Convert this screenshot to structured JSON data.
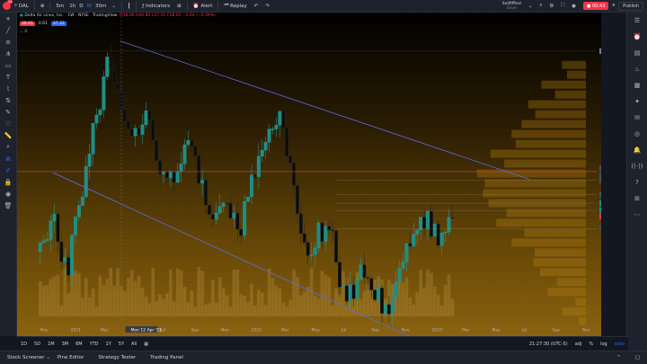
{
  "topbar": {
    "symbol": "DAL",
    "intervals": [
      "5m",
      "1h",
      "D",
      "W",
      "30m"
    ],
    "active_interval": "W",
    "indicators_label": "Indicators",
    "alert_label": "Alert",
    "replay_label": "Replay",
    "layout_name": "Sellfiffied",
    "layout_sub": "Save",
    "rec_time": "00:43",
    "publish_label": "Publish",
    "badge": "11"
  },
  "legend": {
    "title": "Delta Air Lines, Inc. · 1W · NYSE · TradingView",
    "ohlc": "O38.06 H40.80 L37.41 C38.65 −2.64 (−6.39%)",
    "bid": "36.61",
    "spread": "0.61",
    "ask": "37.22",
    "ind": "4"
  },
  "price_axis": {
    "ticks": [
      "53.00",
      "52.00",
      "51.00",
      "50.00",
      "49.00",
      "48.00",
      "47.00",
      "46.00",
      "45.00",
      "44.00",
      "43.00",
      "42.00",
      "41.00",
      "40.00",
      "39.00",
      "38.00",
      "37.00",
      "36.00",
      "35.00",
      "34.00",
      "33.00",
      "32.00",
      "31.00",
      "30.00",
      "29.00",
      "28.00",
      "27.00",
      "26.00"
    ],
    "high_label": "High",
    "high_value": "52.28",
    "low_label": "Low",
    "low_value": "27.20",
    "labels": [
      {
        "text": "51.29",
        "color": "#787b86"
      },
      {
        "text": "40.29",
        "color": "#4a4e5a"
      },
      {
        "text": "40.29",
        "color": "#4a4e5a"
      },
      {
        "text": "39.51",
        "color": "#4a4e5a"
      },
      {
        "text": "38.21",
        "color": "#4a4e5a"
      },
      {
        "text": "37.42",
        "color": "#089981"
      },
      {
        "text": "DAL 36.77",
        "color": "#089981"
      },
      {
        "text": "36.73",
        "color": "#f23645"
      },
      {
        "text": "35.10",
        "color": "#4a4e5a"
      }
    ]
  },
  "time_axis": {
    "labels": [
      "Nov",
      "2021",
      "Mar",
      "Mon 12 Apr '21",
      "Jul",
      "Sep",
      "Nov",
      "2022",
      "Mar",
      "May",
      "Jul",
      "Sep",
      "Nov",
      "2023",
      "Mar",
      "May",
      "Jul",
      "Sep",
      "Nov"
    ]
  },
  "bottombar": {
    "ranges": [
      "1D",
      "5D",
      "1M",
      "3M",
      "6M",
      "YTD",
      "1Y",
      "5Y",
      "All"
    ],
    "clock": "21:27:30 (UTC-5)",
    "adj": "adj",
    "pct": "%",
    "log": "log",
    "auto": "auto"
  },
  "panels": [
    "Stock Screener",
    "Pine Editor",
    "Strategy Tester",
    "Trading Panel"
  ],
  "colors": {
    "up": "#089981",
    "down": "#f23645",
    "accent": "#2962ff",
    "channel": "#5b6ee1"
  }
}
